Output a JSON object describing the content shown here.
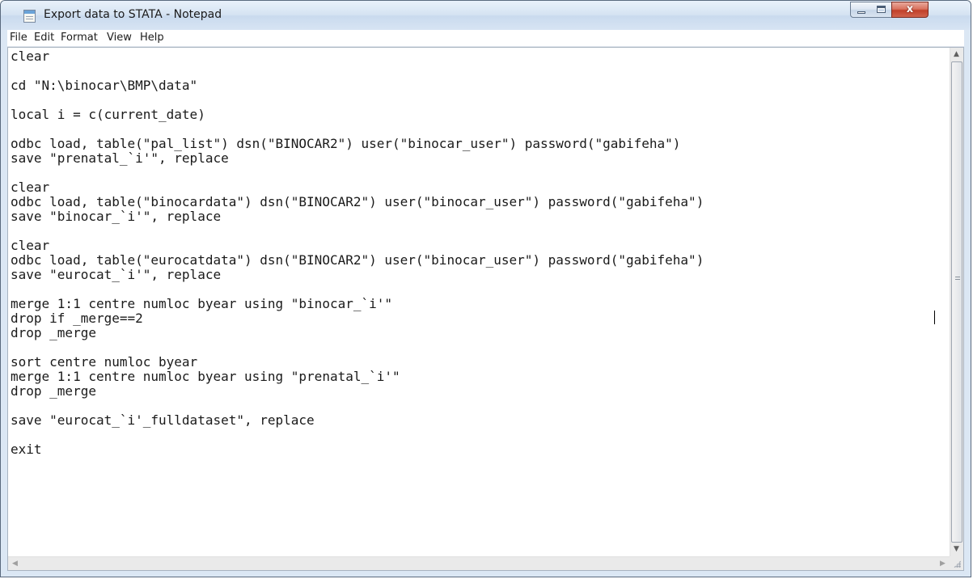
{
  "window": {
    "title": "Export data to STATA - Notepad",
    "minimize_label": "",
    "maximize_label": "",
    "close_label": "x"
  },
  "menu": [
    "File",
    "Edit",
    "Format",
    "View",
    "Help"
  ],
  "editor": {
    "lines": [
      "clear",
      "",
      "cd \"N:\\binocar\\BMP\\data\"",
      "",
      "local i = c(current_date)",
      "",
      "odbc load, table(\"pal_list\") dsn(\"BINOCAR2\") user(\"binocar_user\") password(\"gabifeha\")",
      "save \"prenatal_`i'\", replace",
      "",
      "clear",
      "odbc load, table(\"binocardata\") dsn(\"BINOCAR2\") user(\"binocar_user\") password(\"gabifeha\")",
      "save \"binocar_`i'\", replace",
      "",
      "clear",
      "odbc load, table(\"eurocatdata\") dsn(\"BINOCAR2\") user(\"binocar_user\") password(\"gabifeha\")",
      "save \"eurocat_`i'\", replace",
      "",
      "merge 1:1 centre numloc byear using \"binocar_`i'\"",
      "drop if _merge==2",
      "drop _merge",
      "",
      "sort centre numloc byear",
      "merge 1:1 centre numloc byear using \"prenatal_`i'\"",
      "drop _merge",
      "",
      "save \"eurocat_`i'_fulldataset\", replace",
      "",
      "exit"
    ]
  },
  "scrollbars": {
    "up_arrow": "▲",
    "down_arrow": "▼",
    "left_arrow": "◀",
    "right_arrow": "▶"
  }
}
